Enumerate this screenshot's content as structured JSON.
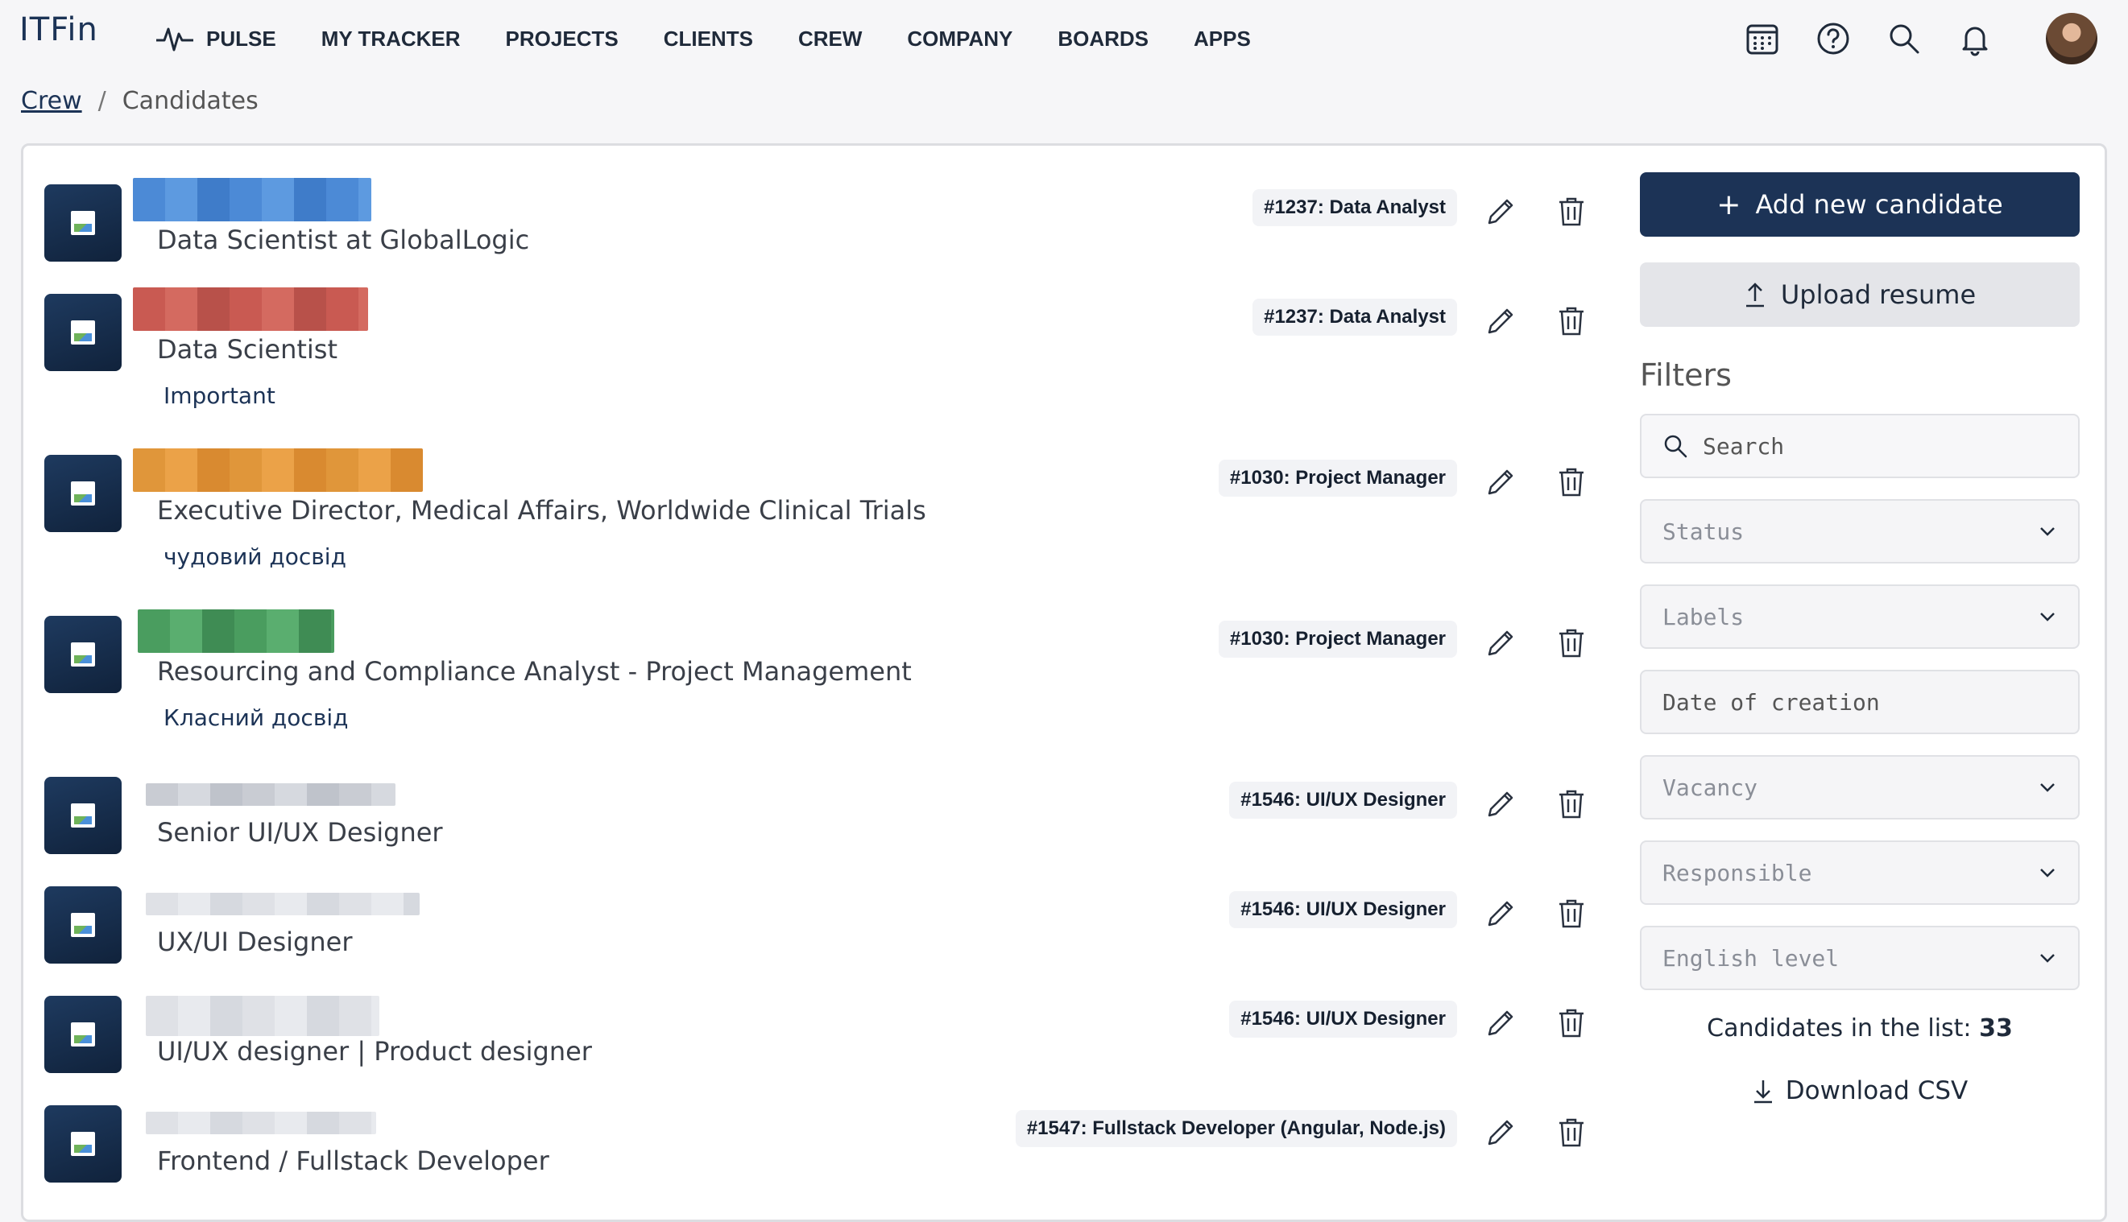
{
  "app": {
    "logo": "ITFin"
  },
  "nav": {
    "items": [
      {
        "label": "PULSE",
        "icon": "pulse-icon"
      },
      {
        "label": "MY TRACKER"
      },
      {
        "label": "PROJECTS"
      },
      {
        "label": "CLIENTS"
      },
      {
        "label": "CREW"
      },
      {
        "label": "COMPANY"
      },
      {
        "label": "BOARDS"
      },
      {
        "label": "APPS"
      }
    ],
    "icons": [
      "calendar-icon",
      "help-icon",
      "search-icon",
      "bell-icon"
    ]
  },
  "breadcrumb": {
    "parent": "Crew",
    "separator": "/",
    "current": "Candidates"
  },
  "candidates": [
    {
      "title": "Data Scientist at GlobalLogic",
      "label": "",
      "vacancy": "#1237: Data Analyst"
    },
    {
      "title": "Data Scientist",
      "label": "Important",
      "vacancy": "#1237: Data Analyst"
    },
    {
      "title": "Executive Director, Medical Affairs, Worldwide Clinical Trials",
      "label": "чудовий досвід",
      "vacancy": "#1030: Project Manager"
    },
    {
      "title": "Resourcing and Compliance Analyst - Project Management",
      "label": "Класний досвід",
      "vacancy": "#1030: Project Manager"
    },
    {
      "title": "Senior UI/UX Designer",
      "label": "",
      "vacancy": "#1546: UI/UX Designer"
    },
    {
      "title": "UX/UI Designer",
      "label": "",
      "vacancy": "#1546: UI/UX Designer"
    },
    {
      "title": "UI/UX designer | Product designer",
      "label": "",
      "vacancy": "#1546: UI/UX Designer"
    },
    {
      "title": "Frontend / Fullstack Developer",
      "label": "",
      "vacancy": "#1547: Fullstack Developer (Angular, Node.js)"
    }
  ],
  "panel": {
    "add_button": "Add new candidate",
    "upload_button": "Upload resume",
    "filters_title": "Filters",
    "search_placeholder": "Search",
    "status_placeholder": "Status",
    "labels_placeholder": "Labels",
    "date_placeholder": "Date of creation",
    "vacancy_placeholder": "Vacancy",
    "responsible_placeholder": "Responsible",
    "english_placeholder": "English level",
    "count_label": "Candidates in the list:",
    "count_value": "33",
    "download_label": "Download CSV"
  },
  "colors": {
    "primary": "#1c3356",
    "background": "#f6f6f8"
  }
}
